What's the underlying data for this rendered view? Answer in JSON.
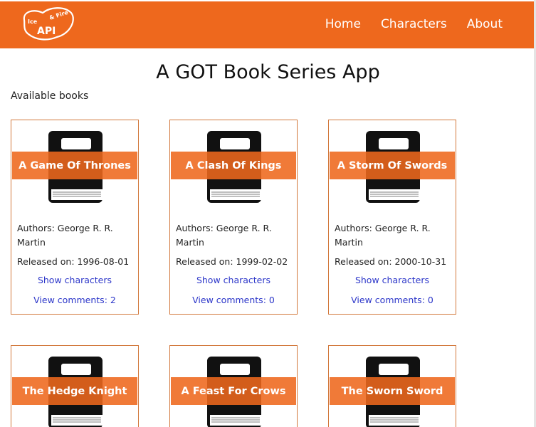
{
  "header": {
    "logo": {
      "main_text": "API",
      "small_left": "Ice",
      "small_right": "& Fire"
    },
    "nav": [
      {
        "label": "Home"
      },
      {
        "label": "Characters"
      },
      {
        "label": "About"
      }
    ]
  },
  "colors": {
    "brand": "#ee681d",
    "link": "#2c36c9",
    "card_border": "#d2783c"
  },
  "page": {
    "title": "A GOT Book Series App",
    "subtitle": "Available books"
  },
  "books": [
    {
      "title": "A Game Of Thrones",
      "authors": "Authors: George R. R. Martin",
      "released": "Released on: 1996-08-01",
      "show_characters": "Show characters",
      "comments": "View comments: 2"
    },
    {
      "title": "A Clash Of Kings",
      "authors": "Authors: George R. R. Martin",
      "released": "Released on: 1999-02-02",
      "show_characters": "Show characters",
      "comments": "View comments: 0"
    },
    {
      "title": "A Storm Of Swords",
      "authors": "Authors: George R. R. Martin",
      "released": "Released on: 2000-10-31",
      "show_characters": "Show characters",
      "comments": "View comments: 0"
    },
    {
      "title": "The Hedge Knight"
    },
    {
      "title": "A Feast For Crows"
    },
    {
      "title": "The Sworn Sword"
    }
  ],
  "icons": {
    "book": "book-icon",
    "logo": "ice-and-fire-logo"
  }
}
